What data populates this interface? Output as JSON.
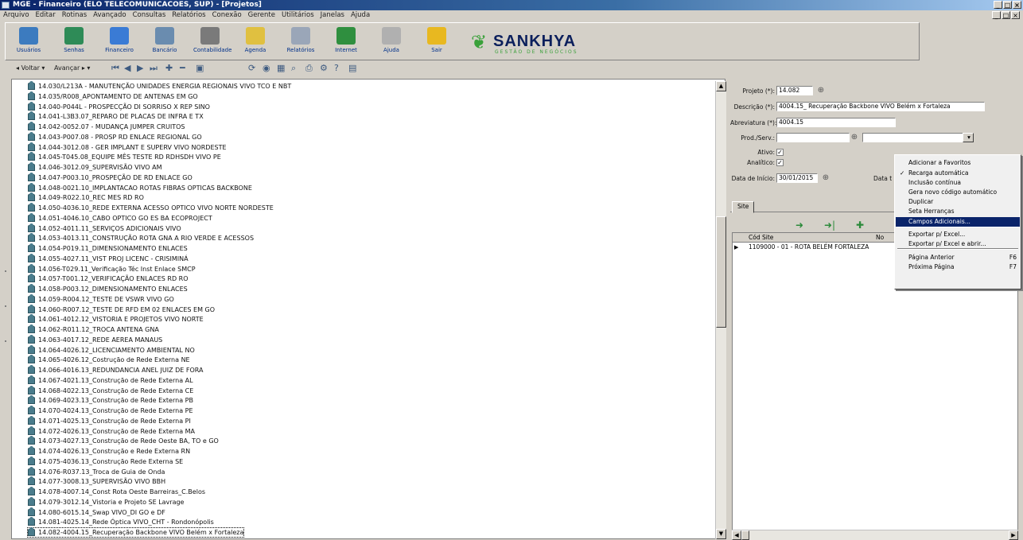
{
  "window": {
    "title": "MGE - Financeiro (ELO TELECOMUNICACOES, SUP) - [Projetos]"
  },
  "menubar": [
    "Arquivo",
    "Editar",
    "Rotinas",
    "Avançado",
    "Consultas",
    "Relatórios",
    "Conexão",
    "Gerente",
    "Utilitários",
    "Janelas",
    "Ajuda"
  ],
  "toolbar": {
    "buttons": [
      {
        "label": "Usuários",
        "icon": "users-icon",
        "color": "#3c7bbf"
      },
      {
        "label": "Senhas",
        "icon": "key-icon",
        "color": "#2e8b57"
      },
      {
        "label": "Financeiro",
        "icon": "money-icon",
        "color": "#3a7bd5"
      },
      {
        "label": "Bancário",
        "icon": "bank-icon",
        "color": "#6a8caf"
      },
      {
        "label": "Contabilidade",
        "icon": "ledger-icon",
        "color": "#7a7a7a"
      },
      {
        "label": "Agenda",
        "icon": "calendar-icon",
        "color": "#e0c040"
      },
      {
        "label": "Relatórios",
        "icon": "report-icon",
        "color": "#9aa6b8"
      },
      {
        "label": "Internet",
        "icon": "internet-icon",
        "color": "#2f8f3f"
      },
      {
        "label": "Ajuda",
        "icon": "help-icon",
        "color": "#b0b0b0"
      },
      {
        "label": "Sair",
        "icon": "exit-icon",
        "color": "#e8b820"
      }
    ]
  },
  "logo": {
    "name": "SANKHYA",
    "tagline": "GESTÃO DE NEGÓCIOS"
  },
  "nav_toolbar": {
    "voltar": "Voltar",
    "avancar": "Avançar"
  },
  "tree": {
    "items": [
      "14.030/L213A - MANUTENÇÃO UNIDADES ENERGIA REGIONAIS VIVO TCO E NBT",
      "14.035/R008_APONTAMENTO DE ANTENAS EM GO",
      "14.040-P044L - PROSPECÇÃO DI SORRISO X REP SINO",
      "14.041-L3B3.07_REPARO DE PLACAS DE INFRA E TX",
      "14.042-0052.07 - MUDANÇA JUMPER CRUITOS",
      "14.043-P007.08 - PROSP RD ENLACE REGIONAL GO",
      "14.044-3012.08 - GER IMPLANT E SUPERV VIVO NORDESTE",
      "14.045-T045.08_EQUIPE MÊS TESTE RD RDHSDH VIVO PE",
      "14.046-3012.09_SUPERVISÃO VIVO AM",
      "14.047-P003.10_PROSPEÇÃO DE RD ENLACE GO",
      "14.048-0021.10_IMPLANTACAO ROTAS FIBRAS OPTICAS BACKBONE",
      "14.049-R022.10_REC MES RD RO",
      "14.050-4036.10_REDE EXTERNA ACESSO OPTICO VIVO NORTE NORDESTE",
      "14.051-4046.10_CABO OPTICO GO ES BA ECOPROJECT",
      "14.052-4011.11_SERVIÇOS ADICIONAIS VIVO",
      "14.053-4013.11_CONSTRUÇÃO ROTA GNA A RIO VERDE E ACESSOS",
      "14.054-P019.11_DIMENSIONAMENTO ENLACES",
      "14.055-4027.11_VIST PROJ LICENC - CRISIMINÁ",
      "14.056-T029.11_Verificação Téc Inst Enlace SMCP",
      "14.057-T001.12_VERIFICAÇÃO ENLACES RD RO",
      "14.058-P003.12_DIMENSIONAMENTO ENLACES",
      "14.059-R004.12_TESTE DE VSWR VIVO GO",
      "14.060-R007.12_TESTE DE RFD EM 02 ENLACES EM GO",
      "14.061-4012.12_VISTORIA E PROJETOS VIVO NORTE",
      "14.062-R011.12_TROCA ANTENA GNA",
      "14.063-4017.12_REDE AEREA MANAUS",
      "14.064-4026.12_LICENCIAMENTO AMBIENTAL NO",
      "14.065-4026.12_Costrução de Rede Externa NE",
      "14.066-4016.13_REDUNDANCIA ANEL JUIZ DE FORA",
      "14.067-4021.13_Construção de Rede Externa AL",
      "14.068-4022.13_Construção de Rede Externa CE",
      "14.069-4023.13_Construção de Rede Externa PB",
      "14.070-4024.13_Construção de Rede Externa PE",
      "14.071-4025.13_Construção de Rede Externa PI",
      "14.072-4026.13_Construção de Rede Externa MA",
      "14.073-4027.13_Construção de Rede Oeste BA, TO e GO",
      "14.074-4026.13_Construção e Rede Externa RN",
      "14.075-4036.13_Construção Rede Externa SE",
      "14.076-R037.13_Troca de Guia de Onda",
      "14.077-3008.13_SUPERVISÃO VIVO BBH",
      "14.078-4007.14_Const Rota Oeste Barreiras_C.Belos",
      "14.079-3012.14_Vistoria e Projeto SE Lavrage",
      "14.080-6015.14_Swap VIVO_DI GO e DF",
      "14.081-4025.14_Rede Óptica VIVO_CHT - Rondonópolis",
      "14.082-4004.15_Recuperação Backbone VIVO Belém x Fortaleza"
    ]
  },
  "form": {
    "projeto_label": "Projeto (*):",
    "projeto_value": "14.082",
    "descricao_label": "Descrição (*):",
    "descricao_value": "4004.15_ Recuperação Backbone VIVO Belém x Fortaleza",
    "abreviatura_label": "Abreviatura (*):",
    "abreviatura_value": "4004.15",
    "prod_serv_label": "Prod./Serv.:",
    "prod_serv_value": "",
    "ativo_label": "Ativo:",
    "ativo_checked": "✓",
    "analitico_label": "Analítico:",
    "analitico_checked": "✓",
    "data_inicio_label": "Data de Início:",
    "data_inicio_value": "30/01/2015",
    "data_t_label": "Data t"
  },
  "tabs": [
    "Site"
  ],
  "grid": {
    "columns": [
      "Cód Site",
      "No"
    ],
    "rows": [
      {
        "value": "1109000 - 01 - ROTA BELÉM FORTALEZA"
      }
    ]
  },
  "context_menu": {
    "items": [
      {
        "label": "Adicionar a Favoritos",
        "checked": "",
        "shortcut": ""
      },
      {
        "label": "Recarga automática",
        "checked": "✓",
        "shortcut": ""
      },
      {
        "label": "Inclusão contínua",
        "checked": "",
        "shortcut": ""
      },
      {
        "label": "Gera novo código automático",
        "checked": "",
        "shortcut": ""
      },
      {
        "label": "Duplicar",
        "checked": "",
        "shortcut": ""
      },
      {
        "label": "Seta Herranças",
        "checked": "",
        "shortcut": ""
      },
      {
        "label": "Campos Adicionais...",
        "checked": "",
        "shortcut": ""
      },
      {
        "label": "Exportar p/ Excel...",
        "checked": "",
        "shortcut": ""
      },
      {
        "label": "Exportar p/ Excel e abrir...",
        "checked": "",
        "shortcut": ""
      },
      {
        "label": "Página Anterior",
        "checked": "",
        "shortcut": "F6"
      },
      {
        "label": "Próxima Página",
        "checked": "",
        "shortcut": "F7"
      }
    ],
    "highlighted_index": 6
  }
}
